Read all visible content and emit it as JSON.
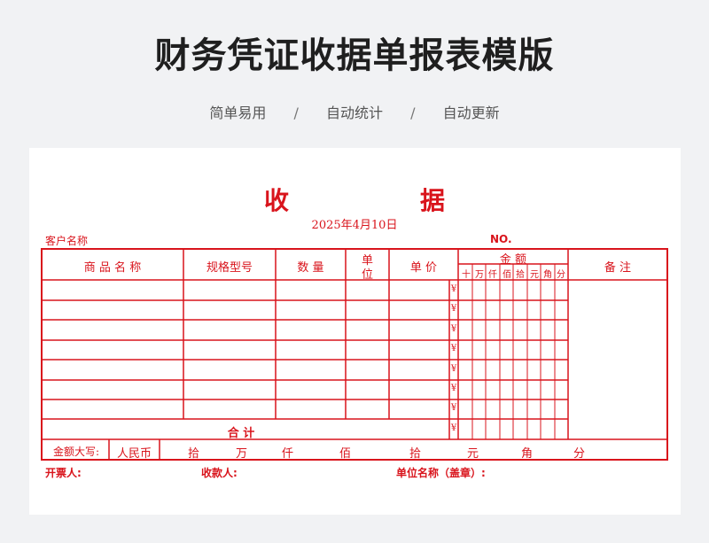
{
  "header": {
    "title": "财务凭证收据单报表模版",
    "features": [
      "简单易用",
      "自动统计",
      "自动更新"
    ],
    "separator": "/"
  },
  "receipt": {
    "title_left": "收",
    "title_right": "据",
    "date": "2025年4月10日",
    "customer_label": "客户名称",
    "number_label": "NO.",
    "columns": {
      "product": "商 品 名 称",
      "spec": "规格型号",
      "qty": "数 量",
      "unit_top": "单",
      "unit_bottom": "位",
      "price": "单 价",
      "amount": "金          额",
      "remark": "备 注"
    },
    "digit_headers": [
      "十",
      "万",
      "仟",
      "佰",
      "拾",
      "元",
      "角",
      "分"
    ],
    "currency_symbol": "¥",
    "row_count": 7,
    "total_label": "合          计",
    "amount_words_label": "金额大写:",
    "currency_name": "人民币",
    "amount_units": [
      "拾",
      "万",
      "仟",
      "佰",
      "拾",
      "元",
      "角",
      "分"
    ],
    "footer": {
      "issuer": "开票人:",
      "payee": "收款人:",
      "org": "单位名称（盖章）:"
    }
  },
  "colors": {
    "accent": "#d9141c",
    "background": "#f1f2f4",
    "title": "#1f1f1f"
  }
}
